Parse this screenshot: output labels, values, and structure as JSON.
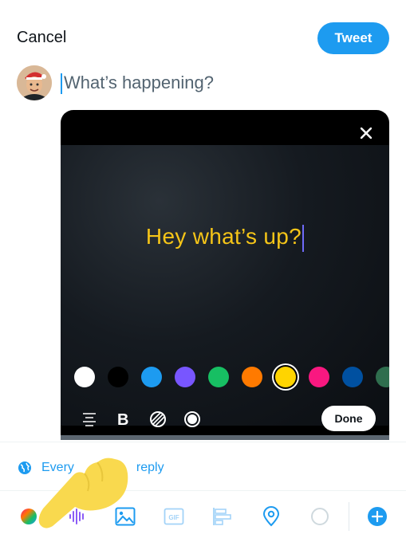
{
  "header": {
    "cancel_label": "Cancel",
    "tweet_label": "Tweet"
  },
  "composer": {
    "placeholder": "What’s happening?"
  },
  "card": {
    "text": "Hey what’s up?",
    "text_color": "#f5c518",
    "colors": [
      "#ffffff",
      "#000000",
      "#1d9bf0",
      "#7856ff",
      "#17bf63",
      "#ff7a00",
      "#ffd400",
      "#f91880",
      "#0050a0",
      "#2f6e4e"
    ],
    "selected_color_index": 6,
    "done_label": "Done"
  },
  "reply": {
    "text_start": "Every",
    "text_end": "reply"
  },
  "toolbar": {
    "icons": [
      "color-wheel-icon",
      "audio-waveform-icon",
      "image-icon",
      "gif-icon",
      "poll-icon",
      "location-icon",
      "char-count-ring-icon",
      "add-icon"
    ],
    "gif_label": "GIF"
  },
  "accent_color": "#1d9bf0"
}
